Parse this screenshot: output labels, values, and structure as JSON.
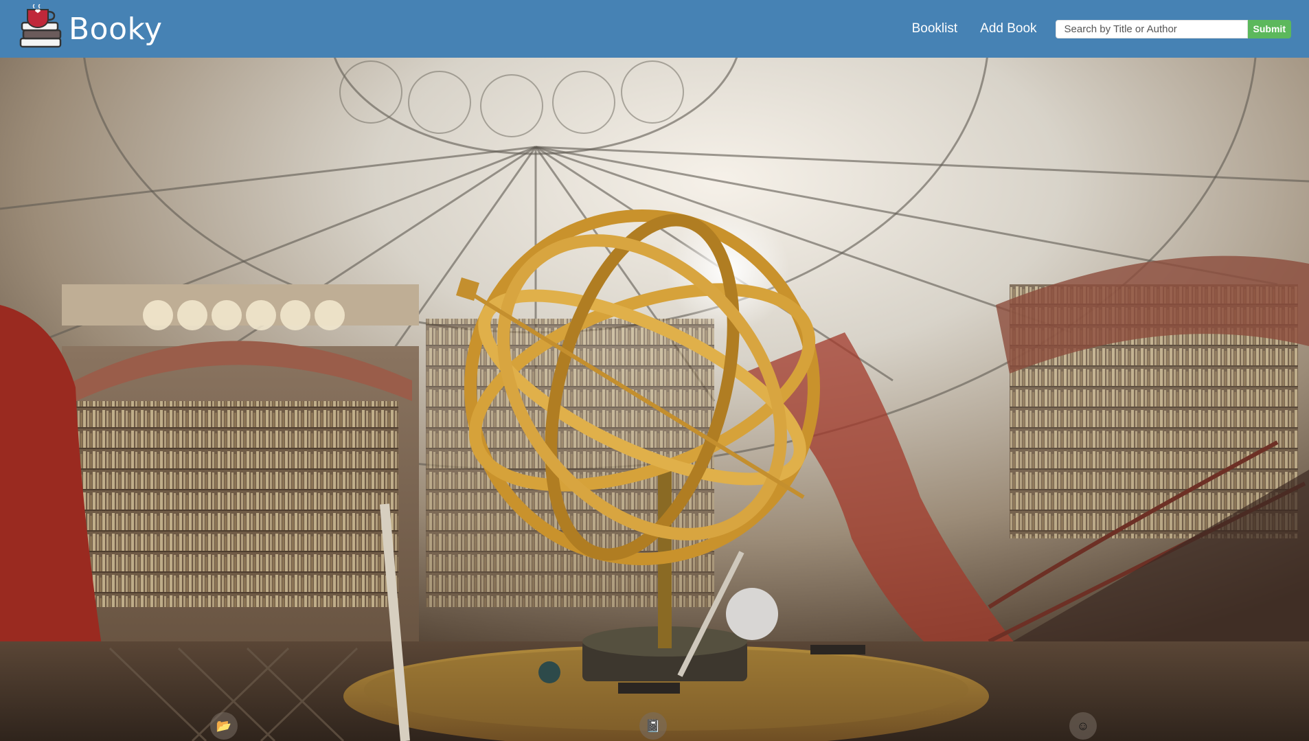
{
  "app": {
    "brand_name": "Booky"
  },
  "nav": {
    "links": [
      {
        "label": "Booklist"
      },
      {
        "label": "Add Book"
      }
    ]
  },
  "search": {
    "placeholder": "Search by Title or Author",
    "value": "",
    "submit_label": "Submit"
  },
  "hero": {
    "background": "library rotunda with golden armillary sphere",
    "feature_icons": [
      {
        "icon": "folder-open-icon",
        "glyph": "📂"
      },
      {
        "icon": "book-icon",
        "glyph": "📓"
      },
      {
        "icon": "smiley-icon",
        "glyph": "☺"
      }
    ]
  },
  "colors": {
    "navbar": "#4682b4",
    "submit": "#5cb85c",
    "brand_text": "#ffffff"
  }
}
